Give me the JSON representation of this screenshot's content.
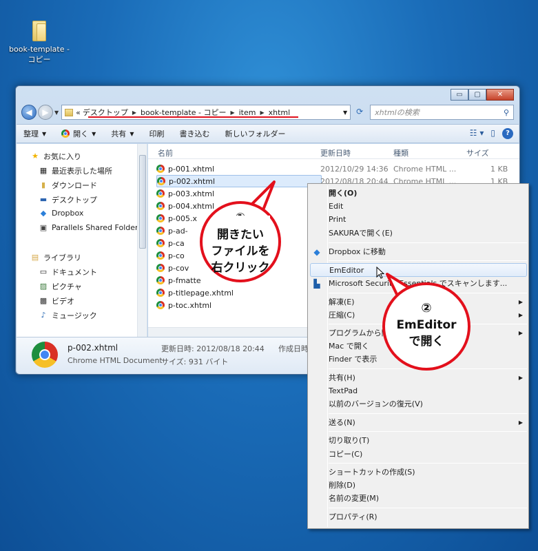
{
  "desktop": {
    "icon_label_line1": "book-template -",
    "icon_label_line2": "コピー"
  },
  "window": {
    "controls": {
      "minimize": "▭",
      "maximize": "▢",
      "close": "✕"
    },
    "breadcrumb_prefix": "«",
    "breadcrumb": [
      "デスクトップ",
      "book-template - コピー",
      "item",
      "xhtml"
    ],
    "search_placeholder": "xhtmlの検索",
    "toolbar": {
      "organize": "整理",
      "open": "開く",
      "share": "共有",
      "print": "印刷",
      "burn": "書き込む",
      "new_folder": "新しいフォルダー"
    },
    "nav_pane": {
      "favorites": "お気に入り",
      "recent_places": "最近表示した場所",
      "downloads": "ダウンロード",
      "desktop": "デスクトップ",
      "dropbox": "Dropbox",
      "parallels": "Parallels Shared Folders",
      "libraries": "ライブラリ",
      "documents": "ドキュメント",
      "pictures": "ピクチャ",
      "videos": "ビデオ",
      "music": "ミュージック"
    },
    "columns": {
      "name": "名前",
      "modified": "更新日時",
      "type": "種類",
      "size": "サイズ"
    },
    "files": [
      {
        "name": "p-001.xhtml",
        "modified": "2012/10/29 14:36",
        "type": "Chrome HTML ...",
        "size": "1 KB"
      },
      {
        "name": "p-002.xhtml",
        "modified": "2012/08/18 20:44",
        "type": "Chrome HTML ...",
        "size": "1 KB"
      },
      {
        "name": "p-003.xhtml"
      },
      {
        "name": "p-004.xhtml"
      },
      {
        "name": "p-005.x"
      },
      {
        "name": "p-ad-"
      },
      {
        "name": "p-ca"
      },
      {
        "name": "p-co"
      },
      {
        "name": "p-cov"
      },
      {
        "name": "p-fmatte"
      },
      {
        "name": "p-titlepage.xhtml"
      },
      {
        "name": "p-toc.xhtml"
      }
    ],
    "details": {
      "filename": "p-002.xhtml",
      "filetype": "Chrome HTML Document",
      "modified": "更新日時: 2012/08/18 20:44",
      "size": "サイズ: 931 バイト",
      "created": "作成日時"
    }
  },
  "context_menu": {
    "open": "開く(O)",
    "edit": "Edit",
    "print": "Print",
    "sakura": "SAKURAで開く(E)",
    "dropbox_move": "Dropbox に移動",
    "emeditor": "EmEditor",
    "mse": "Microsoft Security Essentials でスキャンします...",
    "extract": "解凍(E)",
    "compress": "圧縮(C)",
    "open_with_program": "プログラムから開",
    "open_on_mac": "Mac で開く",
    "show_in_finder": "Finder で表示",
    "share": "共有(H)",
    "textpad": "TextPad",
    "restore_previous": "以前のバージョンの復元(V)",
    "send_to": "送る(N)",
    "cut": "切り取り(T)",
    "copy": "コピー(C)",
    "create_shortcut": "ショートカットの作成(S)",
    "delete": "削除(D)",
    "rename": "名前の変更(M)",
    "properties": "プロパティ(R)"
  },
  "callouts": {
    "step1_num": "①",
    "step1_line1": "開きたい",
    "step1_line2": "ファイルを",
    "step1_line3": "右クリック",
    "step2_num": "②",
    "step2_line1": "EmEditor",
    "step2_line2": "で開く"
  },
  "colors": {
    "accent_red": "#e3101c",
    "selection": "#dcebfc"
  }
}
